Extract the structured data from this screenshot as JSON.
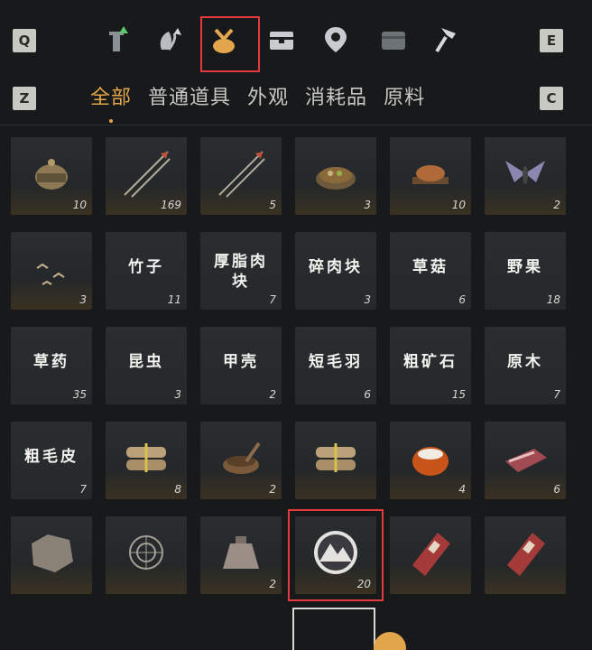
{
  "keys": {
    "q": "Q",
    "e": "E",
    "z": "Z",
    "c": "C"
  },
  "categories": [
    {
      "icon": "tower-icon"
    },
    {
      "icon": "lotus-arrow-icon"
    },
    {
      "icon": "pouch-icon",
      "active": true
    },
    {
      "icon": "chest-icon"
    },
    {
      "icon": "map-pin-icon"
    },
    {
      "icon": "bag-icon"
    },
    {
      "icon": "hammer-icon"
    }
  ],
  "tabs": [
    "全部",
    "普通道具",
    "外观",
    "消耗品",
    "原料"
  ],
  "active_tab": "全部",
  "colors": {
    "accent": "#e3a64a",
    "selection": "#e43a3a",
    "background": "#17191a"
  },
  "items": [
    {
      "icon": "helmet-icon",
      "count": "10"
    },
    {
      "icon": "arrows-icon",
      "count": "169"
    },
    {
      "icon": "arrows-icon",
      "count": "5"
    },
    {
      "icon": "food-bowl-icon",
      "count": "3"
    },
    {
      "icon": "roast-icon",
      "count": "10"
    },
    {
      "icon": "moth-icon",
      "count": "2"
    },
    {
      "icon": "birds-icon",
      "count": "3"
    },
    {
      "name": "竹子",
      "count": "11"
    },
    {
      "name": "厚脂肉块",
      "count": "7"
    },
    {
      "name": "碎肉块",
      "count": "3"
    },
    {
      "name": "草菇",
      "count": "6"
    },
    {
      "name": "野果",
      "count": "18"
    },
    {
      "name": "草药",
      "count": "35"
    },
    {
      "name": "昆虫",
      "count": "3"
    },
    {
      "name": "甲壳",
      "count": "2"
    },
    {
      "name": "短毛羽",
      "count": "6"
    },
    {
      "name": "粗矿石",
      "count": "15"
    },
    {
      "name": "原木",
      "count": "7"
    },
    {
      "name": "粗毛皮",
      "count": "7"
    },
    {
      "icon": "bundle-icon",
      "count": "8"
    },
    {
      "icon": "mortar-bowl-icon",
      "count": "2"
    },
    {
      "icon": "bundle-icon",
      "count": ""
    },
    {
      "icon": "bun-icon",
      "count": "4"
    },
    {
      "icon": "meat-icon",
      "count": "6"
    },
    {
      "icon": "pelt-icon",
      "count": ""
    },
    {
      "icon": "web-trap-icon",
      "count": ""
    },
    {
      "icon": "sack-icon",
      "count": "2"
    },
    {
      "icon": "mountain-emblem-icon",
      "count": "20",
      "selected": true
    },
    {
      "icon": "red-book-icon",
      "count": ""
    },
    {
      "icon": "red-book-icon",
      "count": ""
    }
  ]
}
